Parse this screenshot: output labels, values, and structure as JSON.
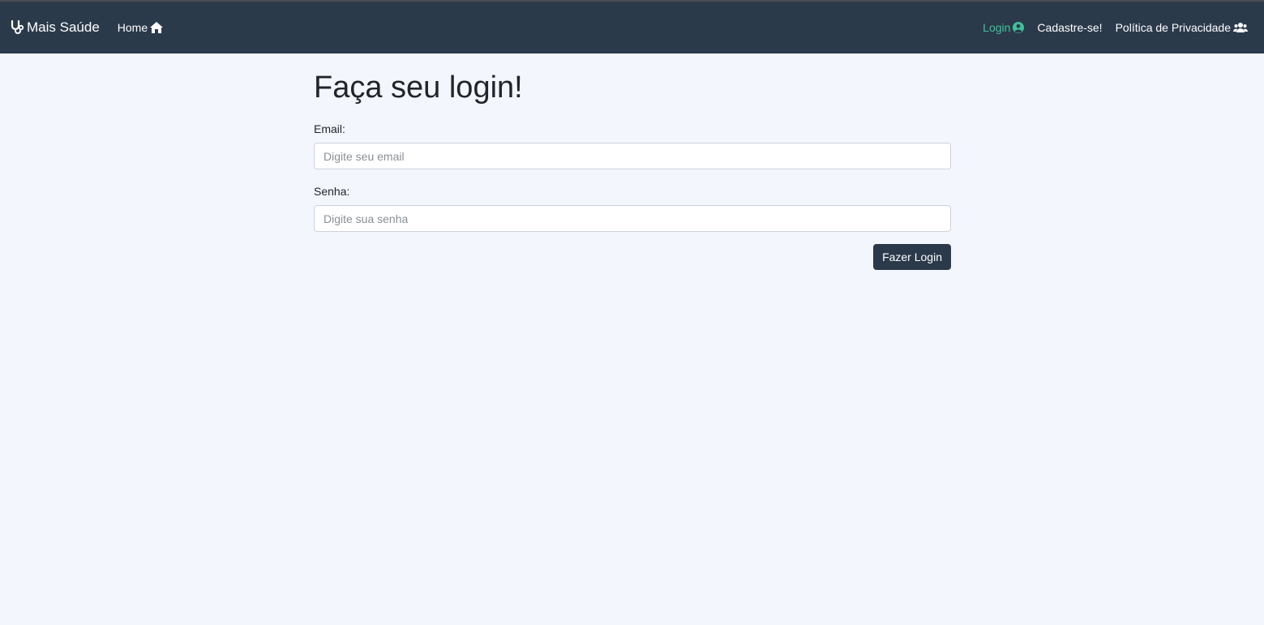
{
  "navbar": {
    "brand": {
      "label": "Mais Saúde",
      "icon": "stethoscope-icon"
    },
    "left_links": [
      {
        "label": "Home",
        "icon": "home-icon"
      }
    ],
    "right_links": [
      {
        "label": "Login",
        "icon": "user-circle-icon",
        "active": true
      },
      {
        "label": "Cadastre-se!"
      },
      {
        "label": "Política de Privacidade",
        "icon": "users-icon"
      }
    ],
    "colors": {
      "background": "#2b3a4b",
      "active_link": "#3fc19a"
    }
  },
  "form": {
    "title": "Faça seu login!",
    "email": {
      "label": "Email:",
      "placeholder": "Digite seu email",
      "value": ""
    },
    "password": {
      "label": "Senha:",
      "placeholder": "Digite sua senha",
      "value": ""
    },
    "submit_label": "Fazer Login"
  },
  "colors": {
    "page_background": "#f4f6fd",
    "button": "#2b3a4b"
  }
}
